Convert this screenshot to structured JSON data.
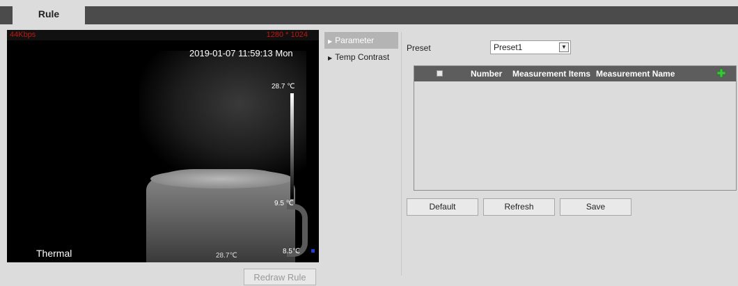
{
  "tabs": {
    "rule": "Rule"
  },
  "video": {
    "bitrate": "44Kbps",
    "resolution": "1280 * 1024",
    "timestamp": "2019-01-07 11:59:13 Mon",
    "scale_max": "28.7 ℃",
    "scale_min": "9.5 ℃",
    "channel": "Thermal",
    "center_temp": "28.7℃",
    "corner_temp": "8.5℃"
  },
  "buttons": {
    "redraw_rule": "Redraw Rule",
    "default": "Default",
    "refresh": "Refresh",
    "save": "Save"
  },
  "menu": [
    {
      "label": "Parameter",
      "active": true
    },
    {
      "label": "Temp Contrast",
      "active": false
    }
  ],
  "preset": {
    "label": "Preset",
    "value": "Preset1"
  },
  "table": {
    "columns": [
      "Number",
      "Measurement Items",
      "Measurement Name"
    ],
    "rows": []
  },
  "colors": {
    "header_bar": "#4b4b4b",
    "table_header": "#5d5d5d",
    "active_menu": "#b4b4b4",
    "overlay_red": "#c3170f",
    "add_icon": "#3cc43c"
  },
  "icons": {
    "add": "plus-icon",
    "menu_arrow": "triangle-right-icon",
    "dropdown": "chevron-down-icon"
  }
}
